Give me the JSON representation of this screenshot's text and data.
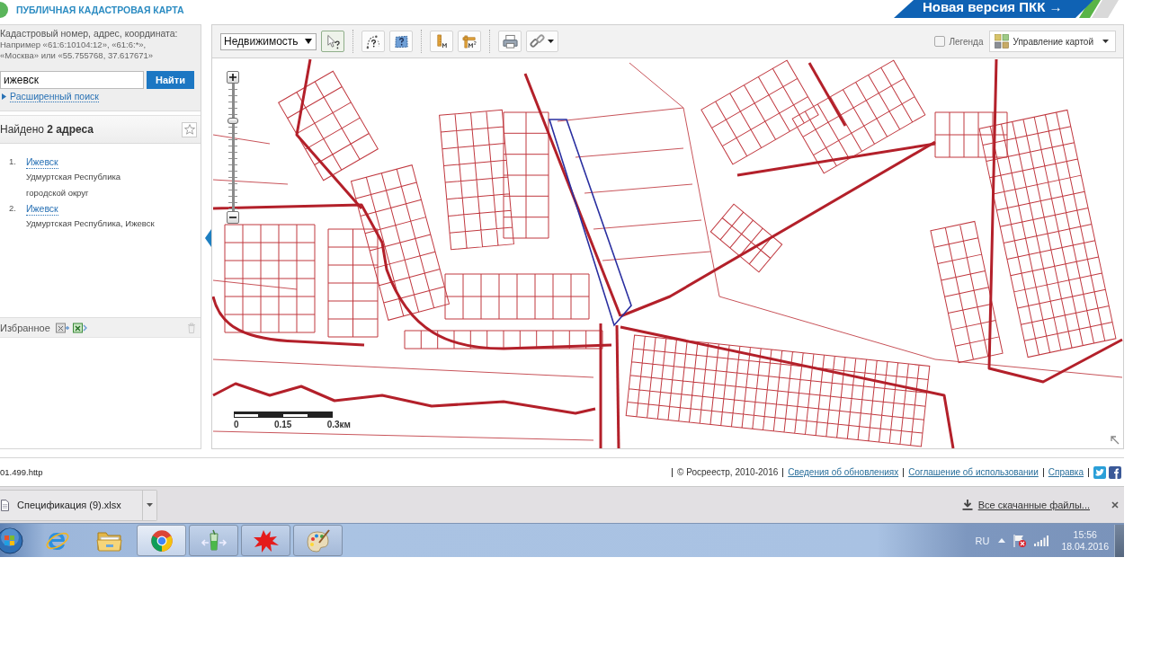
{
  "header": {
    "title": "ПУБЛИЧНАЯ КАДАСТРОВАЯ КАРТА",
    "banner": "Новая версия ПКК →"
  },
  "search": {
    "label": "Кадастровый номер, адрес, координата:",
    "example": "Например «61:6:10104:12», «61:6:*», «Москва» или «55.755768, 37.617671»",
    "value": "ижевск",
    "button": "Найти",
    "advanced_link": "Расширенный поиск"
  },
  "results": {
    "title": "Найдено **2 адреса**",
    "items": [
      {
        "number": "1.",
        "name": "Ижевск",
        "details": [
          "Удмуртская Республика",
          "городской округ"
        ]
      },
      {
        "number": "2.",
        "name": "Ижевск",
        "details": [
          "Удмуртская Республика, Ижевск"
        ]
      }
    ]
  },
  "favorites": {
    "title": "Избранное"
  },
  "toolbar": {
    "layer_select": "Недвижимость",
    "tools": [
      {
        "kind": "identify",
        "selected": true
      },
      {
        "kind": "path-identify",
        "selected": false
      },
      {
        "kind": "area-identify",
        "selected": false
      },
      {
        "kind": "length",
        "selected": false
      },
      {
        "kind": "area",
        "selected": false
      },
      {
        "kind": "print",
        "selected": false
      },
      {
        "kind": "link",
        "selected": false
      }
    ],
    "legend": {
      "label": "Легенда",
      "checked": false
    },
    "map_control": "Управление картой"
  },
  "map": {
    "zoom": {
      "level": 0.72
    },
    "scale": [
      "0",
      "0.15",
      "0.3км"
    ]
  },
  "footer": {
    "status": "01.499.http",
    "copyright": "© Росреестр, 2010-2016",
    "links": [
      "Сведения об обновлениях",
      "Соглашение об использовании",
      "Справка"
    ]
  },
  "downloads": {
    "file": "Спецификация (9).xlsx",
    "all_link": "Все скачанные файлы..."
  },
  "taskbar": {
    "apps": [
      {
        "kind": "ie",
        "open": false,
        "selected": false
      },
      {
        "kind": "folder",
        "open": false,
        "selected": false
      },
      {
        "kind": "chrome",
        "open": true,
        "selected": true
      },
      {
        "kind": "glass",
        "open": true,
        "selected": false
      },
      {
        "kind": "splat",
        "open": true,
        "selected": false
      },
      {
        "kind": "paint",
        "open": true,
        "selected": false
      }
    ],
    "language": "RU",
    "time": "15:56",
    "date": "18.04.2016"
  }
}
